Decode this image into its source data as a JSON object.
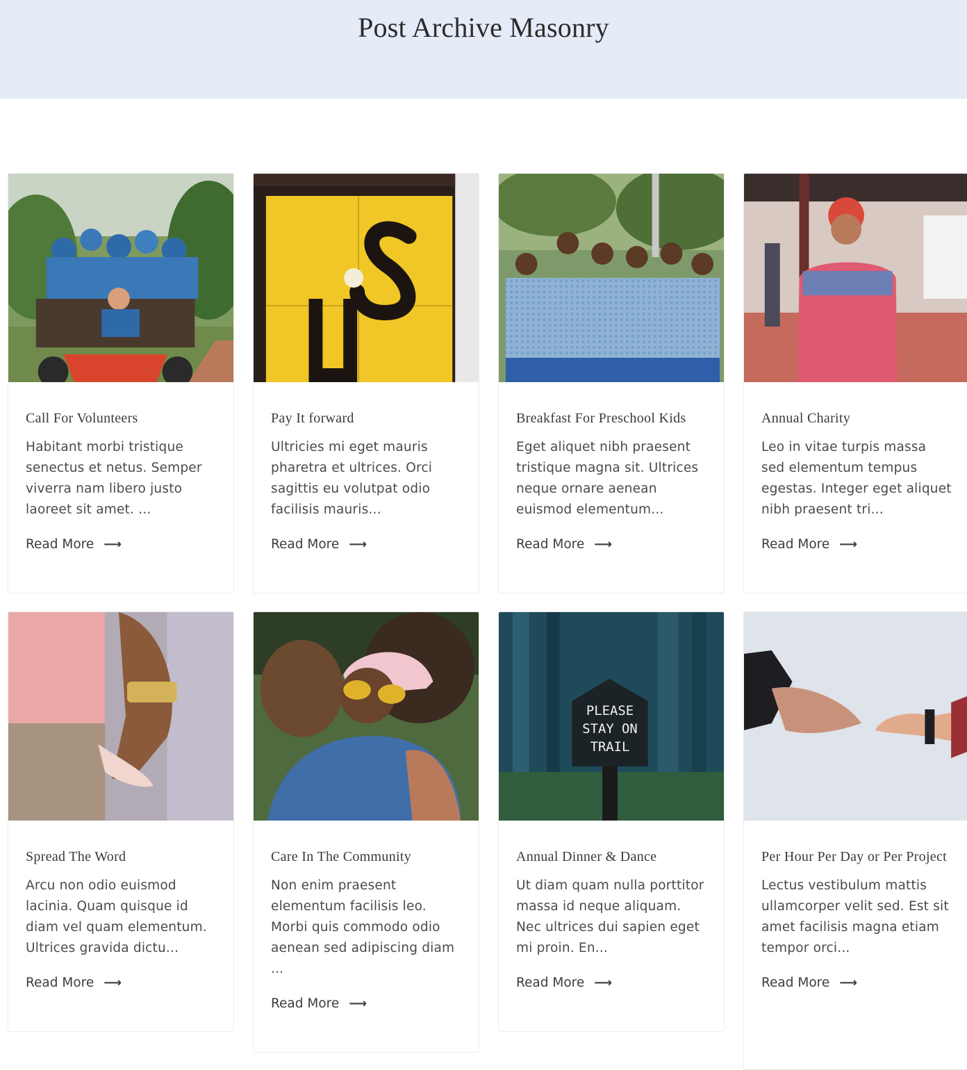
{
  "page": {
    "title": "Post Archive Masonry"
  },
  "colors": {
    "hero_background": "#e5ecf8",
    "card_border": "#ececec",
    "text": "#3c3c3c"
  },
  "posts": [
    {
      "title": "Call For Volunteers",
      "excerpt": "Habitant morbi tristique senectus et netus. Semper viverra nam libero justo laoreet sit amet. ...",
      "read_more": "Read More",
      "image": "volunteers-on-tractor-photo"
    },
    {
      "title": "Pay It forward",
      "excerpt": "Ultricies mi eget mauris pharetra et ultrices. Orci sagittis eu volutpat odio facilisis mauris...",
      "read_more": "Read More",
      "image": "us-yellow-door-photo"
    },
    {
      "title": "Breakfast For Preschool Kids",
      "excerpt": "Eget aliquet nibh praesent tristique magna sit. Ultrices neque ornare aenean euismod elementum...",
      "read_more": "Read More",
      "image": "school-children-group-photo"
    },
    {
      "title": "Annual Charity",
      "excerpt": "Leo in vitae turpis massa sed elementum tempus egestas. Integer eget aliquet nibh praesent tri...",
      "read_more": "Read More",
      "image": "volunteer-shirt-photo"
    },
    {
      "title": "Spread The Word",
      "excerpt": "Arcu non odio euismod lacinia. Quam quisque id diam vel quam elementum. Ultrices gravida dictu...",
      "read_more": "Read More",
      "image": "holding-hands-photo"
    },
    {
      "title": "Care In The Community",
      "excerpt": "Non enim praesent elementum facilisis leo. Morbi quis commodo odio aenean sed adipiscing diam ...",
      "read_more": "Read More",
      "image": "hug-photo"
    },
    {
      "title": "Annual Dinner & Dance",
      "excerpt": "Ut diam quam nulla porttitor massa id neque aliquam. Nec ultrices dui sapien eget mi proin. En...",
      "read_more": "Read More",
      "image": "please-stay-on-trail-sign-photo",
      "sign_text": [
        "PLEASE",
        "STAY ON",
        "TRAIL"
      ]
    },
    {
      "title": "Per Hour Per Day or Per Project",
      "excerpt": "Lectus vestibulum mattis ullamcorper velit sed. Est sit amet facilisis magna etiam tempor orci...",
      "read_more": "Read More",
      "image": "reaching-hands-photo"
    }
  ],
  "icons": {
    "read_more_arrow": "arrow-right-icon",
    "arrow_glyph": "⟶"
  }
}
